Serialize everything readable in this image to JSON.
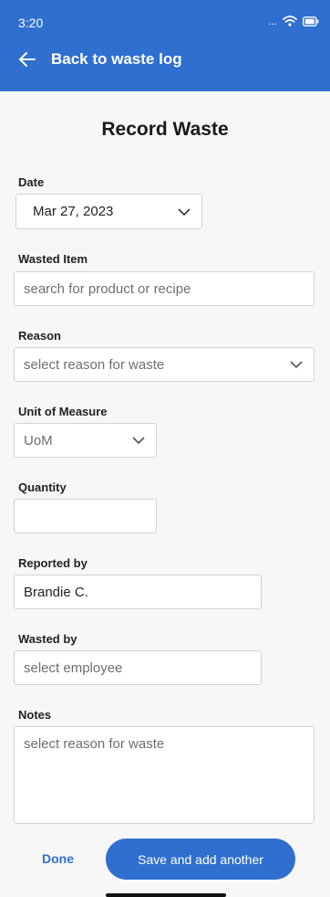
{
  "status": {
    "time": "3:20",
    "dots": "..."
  },
  "nav": {
    "back_label": "Back to waste log"
  },
  "page": {
    "title": "Record Waste"
  },
  "form": {
    "date": {
      "label": "Date",
      "value": "Mar 27, 2023"
    },
    "wasted_item": {
      "label": "Wasted Item",
      "placeholder": "search for product or recipe"
    },
    "reason": {
      "label": "Reason",
      "placeholder": "select reason for waste"
    },
    "uom": {
      "label": "Unit of Measure",
      "placeholder": "UoM"
    },
    "quantity": {
      "label": "Quantity",
      "value": ""
    },
    "reported_by": {
      "label": "Reported by",
      "value": "Brandie C."
    },
    "wasted_by": {
      "label": "Wasted by",
      "placeholder": "select employee"
    },
    "notes": {
      "label": "Notes",
      "placeholder": "select reason for waste"
    }
  },
  "actions": {
    "done_label": "Done",
    "save_another_label": "Save and add another"
  },
  "colors": {
    "brand": "#2f6fcf",
    "background": "#f7f7f8"
  }
}
